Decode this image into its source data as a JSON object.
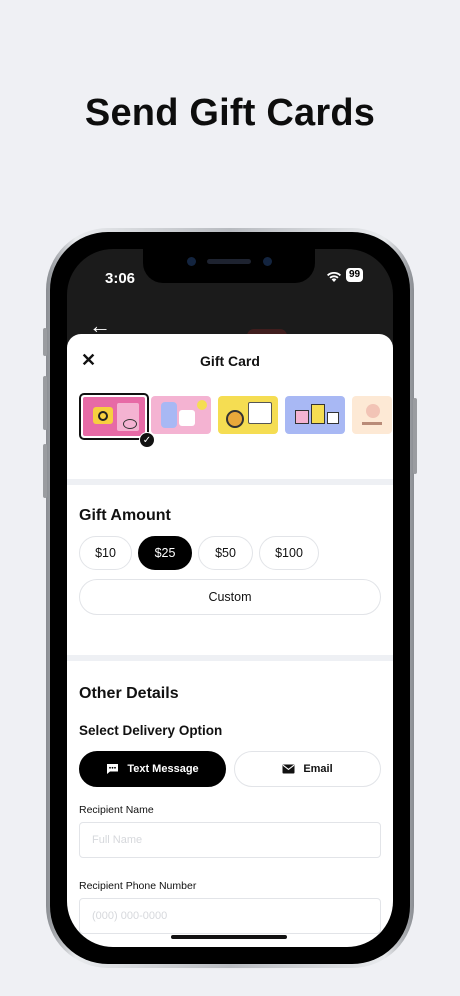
{
  "headline": "Send Gift Cards",
  "status_bar": {
    "time": "3:06",
    "battery": "99"
  },
  "sheet": {
    "title": "Gift Card",
    "close_icon": "close-icon",
    "card_designs": [
      {
        "name": "camera-design",
        "color": "#e76aa6",
        "selected": true
      },
      {
        "name": "coffee-design",
        "color": "#f4b3d2"
      },
      {
        "name": "coins-design",
        "color": "#f5dd52"
      },
      {
        "name": "gifts-design",
        "color": "#a8b8f4"
      },
      {
        "name": "enjoy-design",
        "color": "#fde9d5"
      }
    ],
    "gift_amount": {
      "title": "Gift Amount",
      "options": [
        "$10",
        "$25",
        "$50",
        "$100"
      ],
      "selected": "$25",
      "custom_label": "Custom"
    },
    "other_details": {
      "title": "Other Details",
      "delivery_title": "Select Delivery Option",
      "text_message_label": "Text Message",
      "email_label": "Email",
      "selected_delivery": "Text Message",
      "recipient_name_label": "Recipient Name",
      "recipient_name_placeholder": "Full Name",
      "recipient_phone_label": "Recipient Phone Number",
      "recipient_phone_placeholder": "(000) 000-0000"
    }
  },
  "colors": {
    "accent": "#000000",
    "background": "#eff0f4",
    "border": "#e2e4e8"
  }
}
